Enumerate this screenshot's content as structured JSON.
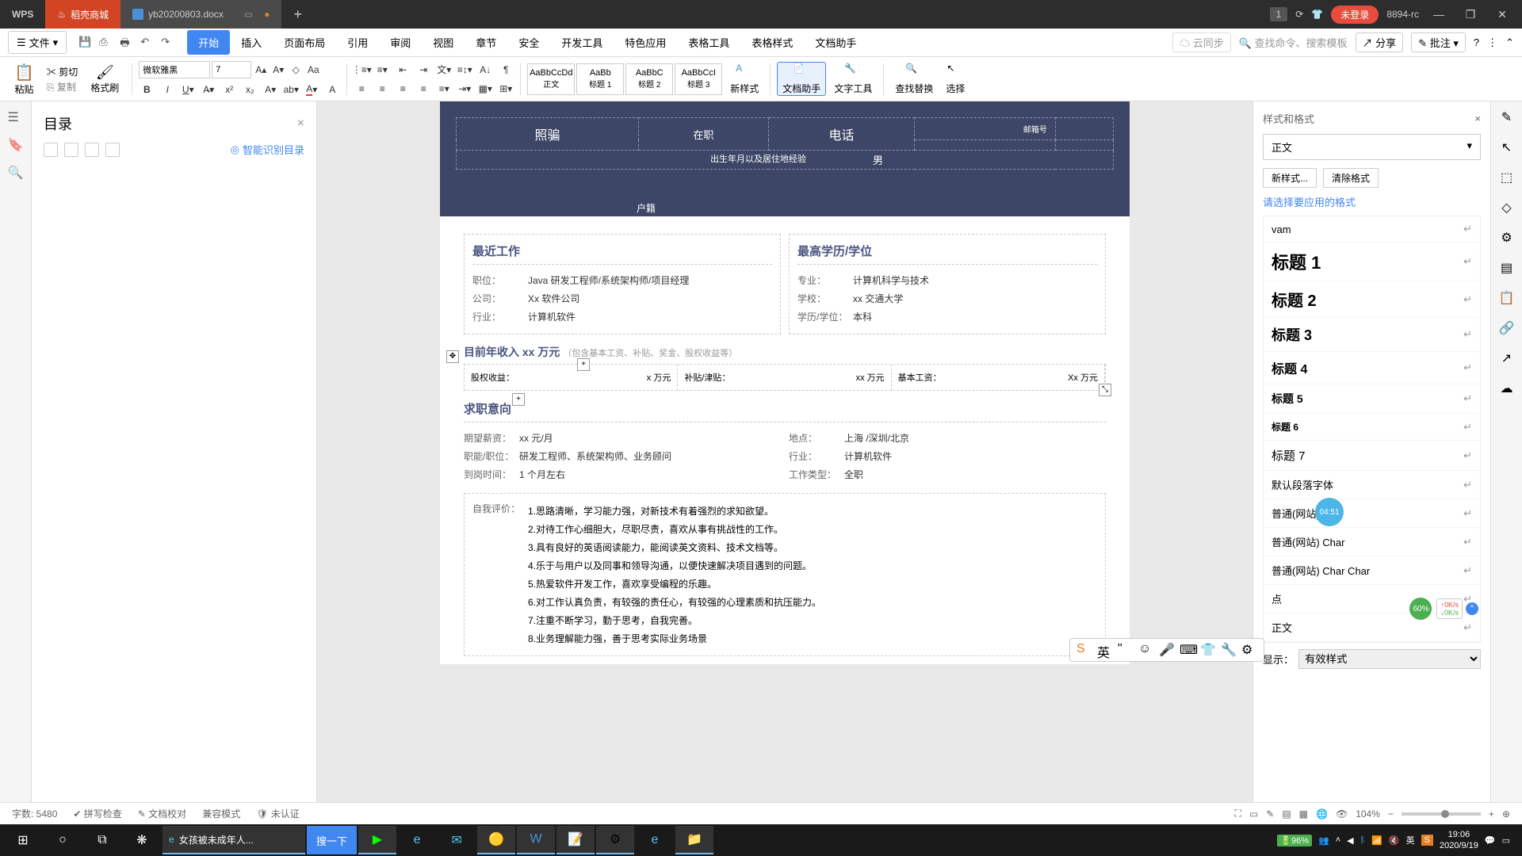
{
  "titlebar": {
    "logo": "WPS",
    "tabs": [
      {
        "label": "稻壳商城",
        "type": "orange"
      },
      {
        "label": "yb20200803.docx",
        "type": "active"
      }
    ],
    "counter": "1",
    "login": "未登录",
    "version": "8894-rc"
  },
  "menubar": {
    "file": "文件",
    "items": [
      "开始",
      "插入",
      "页面布局",
      "引用",
      "审阅",
      "视图",
      "章节",
      "安全",
      "开发工具",
      "特色应用",
      "表格工具",
      "表格样式",
      "文档助手"
    ],
    "active_index": 0,
    "cloud_sync": "云同步",
    "search_placeholder": "查找命令、搜索模板",
    "share": "分享",
    "approve": "批注"
  },
  "ribbon": {
    "paste": "粘贴",
    "cut": "剪切",
    "copy": "复制",
    "format_painter": "格式刷",
    "font_name": "微软雅黑",
    "font_size": "7",
    "styles": [
      {
        "preview": "AaBbCcDd",
        "label": "正文"
      },
      {
        "preview": "AaBb",
        "label": "标题 1"
      },
      {
        "preview": "AaBbC",
        "label": "标题 2"
      },
      {
        "preview": "AaBbCcI",
        "label": "标题 3"
      }
    ],
    "new_style": "新样式",
    "doc_helper": "文档助手",
    "text_tools": "文字工具",
    "find_replace": "查找替换",
    "select": "选择"
  },
  "outline": {
    "title": "目录",
    "smart": "智能识别目录"
  },
  "document": {
    "header": {
      "photo": "照骗",
      "status": "在职",
      "phone": "电话",
      "zip_label": "邮箱号",
      "gender": "男",
      "birth_addr": "出生年月以及居住地经验",
      "huji": "户籍"
    },
    "recent_work": {
      "title": "最近工作",
      "rows": [
        {
          "label": "职位：",
          "value": "Java 研发工程师/系统架构师/项目经理"
        },
        {
          "label": "公司：",
          "value": "Xx 软件公司"
        },
        {
          "label": "行业：",
          "value": "计算机软件"
        }
      ]
    },
    "education": {
      "title": "最高学历/学位",
      "rows": [
        {
          "label": "专业：",
          "value": "计算机科学与技术"
        },
        {
          "label": "学校：",
          "value": "xx 交通大学"
        },
        {
          "label": "学历/学位：",
          "value": "本科"
        }
      ]
    },
    "income": {
      "title_prefix": "目前年收入",
      "title_amount": "xx 万元",
      "title_note": "（包含基本工资、补贴、奖金、股权收益等）",
      "cells": [
        {
          "label": "基本工资：",
          "value": "Xx 万元"
        },
        {
          "label": "补贴/津贴：",
          "value": "xx 万元"
        },
        {
          "label": "股权收益：",
          "value": "x 万元"
        }
      ]
    },
    "intention": {
      "title": "求职意向",
      "left": [
        {
          "label": "期望薪资：",
          "value": "xx 元/月"
        },
        {
          "label": "职能/职位：",
          "value": "研发工程师、系统架构师、业务顾问"
        },
        {
          "label": "到岗时间：",
          "value": "1 个月左右"
        }
      ],
      "right": [
        {
          "label": "地点：",
          "value": "上海 /深圳/北京"
        },
        {
          "label": "行业：",
          "value": "计算机软件"
        },
        {
          "label": "工作类型：",
          "value": "全职"
        }
      ]
    },
    "self_eval": {
      "label": "自我评价：",
      "lines": [
        "1.思路清晰，学习能力强，对新技术有着强烈的求知欲望。",
        "2.对待工作心细胆大，尽职尽责，喜欢从事有挑战性的工作。",
        "3.具有良好的英语阅读能力，能阅读英文资料、技术文档等。",
        "4.乐于与用户以及同事和领导沟通，以便快速解决项目遇到的问题。",
        "5.热爱软件开发工作，喜欢享受编程的乐趣。",
        "6.对工作认真负责，有较强的责任心，有较强的心理素质和抗压能力。",
        "7.注重不断学习，勤于思考，自我完善。",
        "8.业务理解能力强，善于思考实际业务场景"
      ]
    }
  },
  "styles_panel": {
    "header": "样式和格式",
    "current": "正文",
    "new_style_btn": "新样式...",
    "clear_btn": "清除格式",
    "prompt": "请选择要应用的格式",
    "items": [
      {
        "label": "vam",
        "cls": ""
      },
      {
        "label": "标题 1",
        "cls": "h1"
      },
      {
        "label": "标题 2",
        "cls": "h2"
      },
      {
        "label": "标题 3",
        "cls": "h3"
      },
      {
        "label": "标题 4",
        "cls": "h4"
      },
      {
        "label": "标题 5",
        "cls": "h5"
      },
      {
        "label": "标题 6",
        "cls": "h6"
      },
      {
        "label": "标题 7",
        "cls": "h7"
      },
      {
        "label": "默认段落字体",
        "cls": ""
      },
      {
        "label": "普通(网站)",
        "cls": ""
      },
      {
        "label": "普通(网站) Char",
        "cls": ""
      },
      {
        "label": "普通(网站) Char Char",
        "cls": ""
      },
      {
        "label": "点",
        "cls": ""
      },
      {
        "label": "正文",
        "cls": ""
      }
    ],
    "display_label": "显示：",
    "display_value": "有效样式"
  },
  "statusbar": {
    "word_count": "字数: 5480",
    "spellcheck": "拼写检查",
    "doc_proof": "文档校对",
    "compat": "兼容模式",
    "uncert": "未认证",
    "zoom": "104%"
  },
  "taskbar": {
    "browser_title": "女孩被未成年人...",
    "search": "搜一下",
    "battery": "96%",
    "ime": "英",
    "time": "19:06",
    "date": "2020/9/19"
  },
  "floating": {
    "timer": "04:51",
    "net_pct": "60%",
    "net_up": "0K/s",
    "net_down": "0K/s"
  },
  "ime_toolbar": {
    "lang": "英"
  }
}
